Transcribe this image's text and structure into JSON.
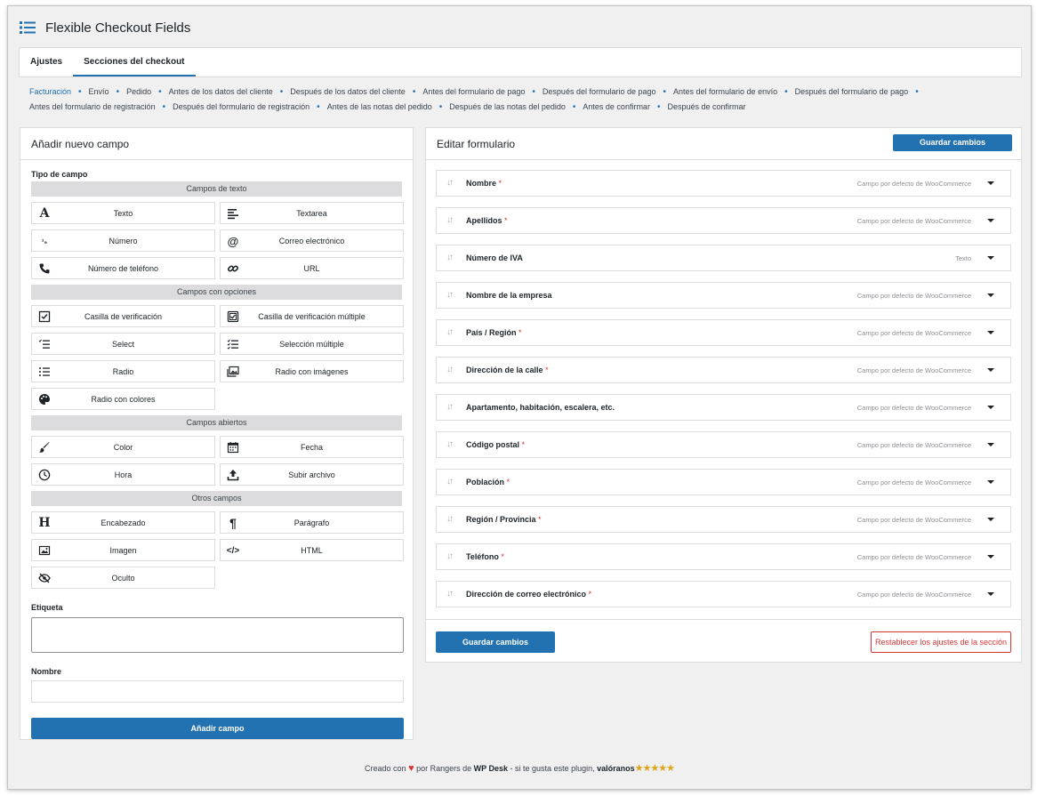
{
  "app": {
    "title": "Flexible Checkout Fields"
  },
  "tabs": [
    {
      "label": "Ajustes"
    },
    {
      "label": "Secciones del checkout"
    }
  ],
  "subnav": [
    "Facturación",
    "Envío",
    "Pedido",
    "Antes de los datos del cliente",
    "Después de los datos del cliente",
    "Antes del formulario de pago",
    "Después del formulario de pago",
    "Antes del formulario de envío",
    "Después del formulario de pago",
    "Antes del formulario de registración",
    "Después del formulario de registración",
    "Antes de las notas del pedido",
    "Después de las notas del pedido",
    "Antes de confirmar",
    "Después de confirmar"
  ],
  "left_panel": {
    "title": "Añadir nuevo campo",
    "field_type_label": "Tipo de campo",
    "groups": [
      {
        "header": "Campos de texto",
        "items": [
          "Texto",
          "Textarea",
          "Número",
          "Correo electrónico",
          "Número de teléfono",
          "URL"
        ]
      },
      {
        "header": "Campos con opciones",
        "items": [
          "Casilla de verificación",
          "Casilla de verificación múltiple",
          "Select",
          "Selección múltiple",
          "Radio",
          "Radio con imágenes",
          "Radio con colores"
        ]
      },
      {
        "header": "Campos abiertos",
        "items": [
          "Color",
          "Fecha",
          "Hora",
          "Subir archivo"
        ]
      },
      {
        "header": "Otros campos",
        "items": [
          "Encabezado",
          "Parágrafo",
          "Imagen",
          "HTML",
          "Oculto"
        ]
      }
    ],
    "label_label": "Etiqueta",
    "label_value": "",
    "name_label": "Nombre",
    "name_value": "",
    "add_button": "Añadir campo"
  },
  "right_panel": {
    "title": "Editar formulario",
    "save_label": "Guardar cambios",
    "reset_label": "Restablecer los ajustes de la sección",
    "fields": [
      {
        "name": "Nombre",
        "required": "*",
        "tag": "Campo por defecto de WooCommerce"
      },
      {
        "name": "Apellidos",
        "required": "*",
        "tag": "Campo por defecto de WooCommerce"
      },
      {
        "name": "Número de IVA",
        "required": "",
        "tag": "Texto"
      },
      {
        "name": "Nombre de la empresa",
        "required": "",
        "tag": "Campo por defecto de WooCommerce"
      },
      {
        "name": "País / Región",
        "required": "*",
        "tag": "Campo por defecto de WooCommerce"
      },
      {
        "name": "Dirección de la calle",
        "required": "*",
        "tag": "Campo por defecto de WooCommerce"
      },
      {
        "name": "Apartamento, habitación, escalera, etc.",
        "required": "",
        "tag": "Campo por defecto de WooCommerce"
      },
      {
        "name": "Código postal",
        "required": "*",
        "tag": "Campo por defecto de WooCommerce"
      },
      {
        "name": "Población",
        "required": "*",
        "tag": "Campo por defecto de WooCommerce"
      },
      {
        "name": "Región / Provincia",
        "required": "*",
        "tag": "Campo por defecto de WooCommerce"
      },
      {
        "name": "Teléfono",
        "required": "*",
        "tag": "Campo por defecto de WooCommerce"
      },
      {
        "name": "Dirección de correo electrónico",
        "required": "*",
        "tag": "Campo por defecto de WooCommerce"
      }
    ]
  },
  "footer": {
    "prefix": "Creado con",
    "middle": "por Rangers de",
    "brand": "WP Desk",
    "suffix": "- si te gusta este plugin,",
    "cta": "valóranos",
    "stars": "★★★★★"
  },
  "colors": {
    "accent": "#2271b1",
    "danger": "#d63638",
    "star": "#dba617"
  }
}
